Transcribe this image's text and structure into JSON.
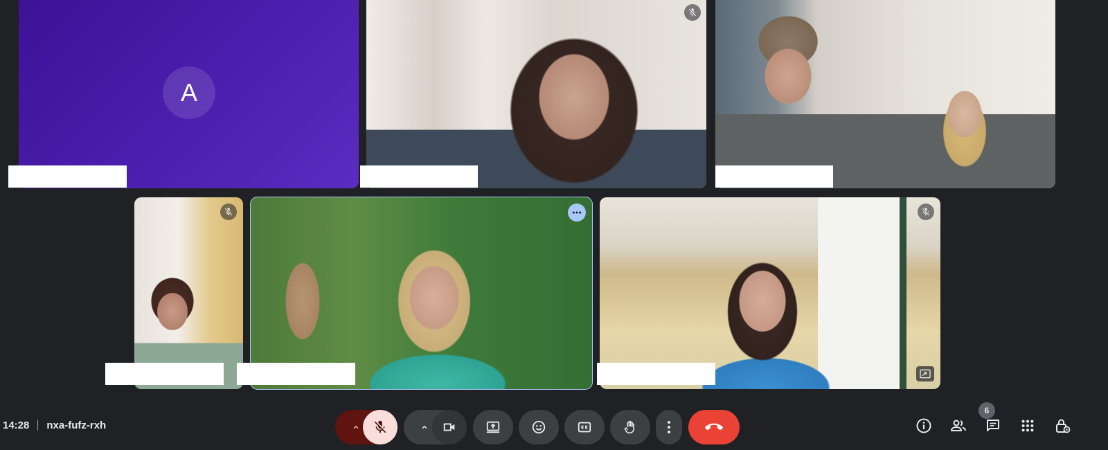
{
  "meeting": {
    "time": "14:28",
    "code": "nxa-fufz-rxh"
  },
  "participants": [
    {
      "id": "p1",
      "avatar_letter": "A",
      "tile_color": "#4a1aa6",
      "mic_muted": false
    },
    {
      "id": "p2",
      "mic_muted": true
    },
    {
      "id": "p3",
      "mic_muted": false
    },
    {
      "id": "p4",
      "mic_muted": true
    },
    {
      "id": "p5",
      "mic_muted": false,
      "speaking": true
    },
    {
      "id": "p6",
      "mic_muted": true
    }
  ],
  "people_count": "6",
  "controls": [
    {
      "name": "mic-options",
      "icon": "chevron-up-icon"
    },
    {
      "name": "microphone",
      "icon": "mic-off-icon",
      "state": "muted"
    },
    {
      "name": "camera-options",
      "icon": "chevron-up-icon"
    },
    {
      "name": "camera",
      "icon": "videocam-icon"
    },
    {
      "name": "present",
      "icon": "present-screen-icon"
    },
    {
      "name": "reactions",
      "icon": "emoji-icon"
    },
    {
      "name": "captions",
      "icon": "closed-caption-icon"
    },
    {
      "name": "raise-hand",
      "icon": "hand-icon"
    },
    {
      "name": "more-options",
      "icon": "more-vert-icon"
    },
    {
      "name": "leave-call",
      "icon": "call-end-icon"
    }
  ],
  "side_controls": [
    "info-icon",
    "people-icon",
    "chat-icon",
    "activities-icon",
    "host-controls-icon"
  ],
  "colors": {
    "background": "#202124",
    "leave": "#ea4335",
    "mic_muted_bg": "#f9dedc",
    "accent": "#a8c7fa"
  }
}
